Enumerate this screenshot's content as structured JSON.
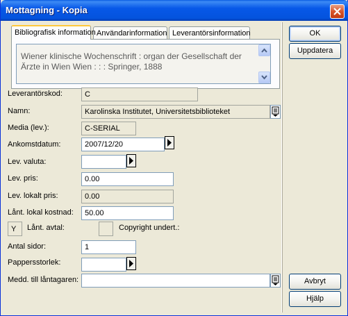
{
  "window": {
    "title": "Mottagning - Kopia"
  },
  "tabs": [
    {
      "label": "Bibliografisk information"
    },
    {
      "label": "Användarinformation"
    },
    {
      "label": "Leverantörsinformation"
    }
  ],
  "bib_memo": {
    "text": "Wiener klinische Wochenschrift : organ der Gesellschaft der Ärzte in Wien Wien : : : Springer, 1888"
  },
  "form": {
    "supplier_code": {
      "label": "Leverantörskod:",
      "value": "C"
    },
    "name": {
      "label": "Namn:",
      "value": "Karolinska Institutet, Universitetsbiblioteket"
    },
    "media": {
      "label": "Media (lev.):",
      "value": "C-SERIAL"
    },
    "arrival_date": {
      "label": "Ankomstdatum:",
      "value": "2007/12/20"
    },
    "currency": {
      "label": "Lev. valuta:",
      "value": ""
    },
    "price": {
      "label": "Lev. pris:",
      "value": "0.00"
    },
    "local_price": {
      "label": "Lev. lokalt pris:",
      "value": "0.00"
    },
    "loan_cost": {
      "label": "Lånt. lokal kostnad:",
      "value": "50.00"
    },
    "loan_agreement": {
      "label": "Lånt. avtal:",
      "value": "Y"
    },
    "copyright": {
      "label": "Copyright undert.:",
      "value": ""
    },
    "pages": {
      "label": "Antal sidor:",
      "value": "1"
    },
    "paper_size": {
      "label": "Pappersstorlek:",
      "value": ""
    },
    "message": {
      "label": "Medd. till låntagaren:",
      "value": ""
    }
  },
  "buttons": {
    "ok": "OK",
    "update": "Uppdatera",
    "cancel": "Avbryt",
    "help": "Hjälp"
  }
}
